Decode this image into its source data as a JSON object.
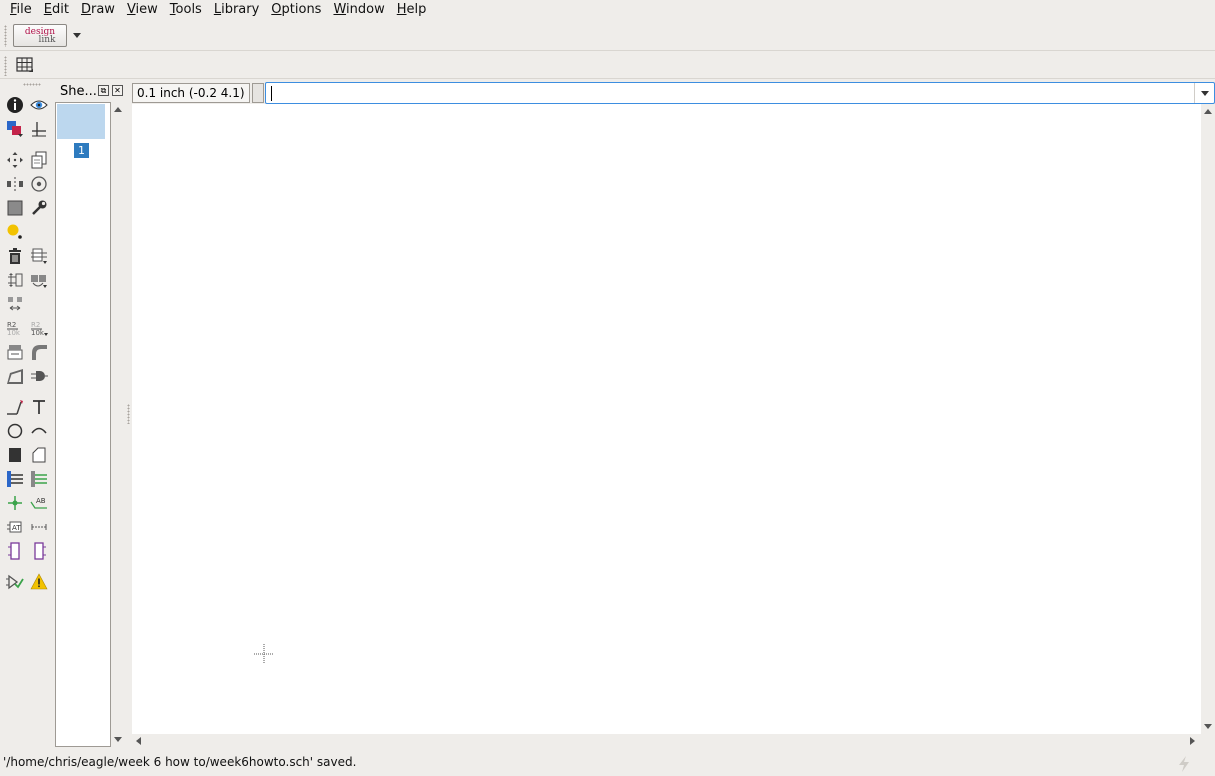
{
  "menu": [
    {
      "name": "file",
      "label": "File",
      "u": "F",
      "rest": "ile"
    },
    {
      "name": "edit",
      "label": "Edit",
      "u": "E",
      "rest": "dit"
    },
    {
      "name": "draw",
      "label": "Draw",
      "u": "D",
      "rest": "raw"
    },
    {
      "name": "view",
      "label": "View",
      "u": "V",
      "rest": "iew"
    },
    {
      "name": "tools",
      "label": "Tools",
      "u": "T",
      "rest": "ools"
    },
    {
      "name": "library",
      "label": "Library",
      "u": "L",
      "rest": "ibrary"
    },
    {
      "name": "options",
      "label": "Options",
      "u": "O",
      "rest": "ptions"
    },
    {
      "name": "window",
      "label": "Window",
      "u": "W",
      "rest": "indow"
    },
    {
      "name": "help",
      "label": "Help",
      "u": "H",
      "rest": "elp"
    }
  ],
  "toolbar": {
    "design_link_top": "design",
    "design_link_bottom": "link"
  },
  "sheets": {
    "title": "She...",
    "float_glyph": "⧉",
    "close_glyph": "✕",
    "items": [
      {
        "number": "1"
      }
    ]
  },
  "coords": {
    "grid_readout": "0.1 inch (-0.2 4.1)"
  },
  "command": {
    "value": "",
    "placeholder": ""
  },
  "status": {
    "message": "'/home/chris/eagle/week 6 how to/week6howto.sch' saved."
  },
  "tool_icons": [
    "info-icon",
    "show-icon",
    "display-layers-icon",
    "mark-icon",
    "move-icon",
    "copy-icon",
    "mirror-icon",
    "rotate-icon",
    "group-icon",
    "change-icon",
    "paste-icon",
    "delete-icon",
    "add-icon",
    "pinswap-icon",
    "replace-icon",
    "gateswap-icon",
    "name-icon",
    "value-icon",
    "smash-icon",
    "miter-icon",
    "split-icon",
    "invoke-icon",
    "wire-icon",
    "text-icon",
    "circle-icon",
    "arc-icon",
    "rect-icon",
    "polygon-icon",
    "bus-icon",
    "net-icon",
    "junction-icon",
    "label-icon",
    "attribute-icon",
    "dimension-icon",
    "frame-icon",
    "frame2-icon",
    "erc-icon",
    "errors-icon"
  ],
  "colors": {
    "accent": "#3d8ee0",
    "sheet_selected": "#bcd7ee",
    "sheet_number_bg": "#2e7bbf",
    "warning": "#f2c200",
    "design_link_red": "#b0124a"
  }
}
